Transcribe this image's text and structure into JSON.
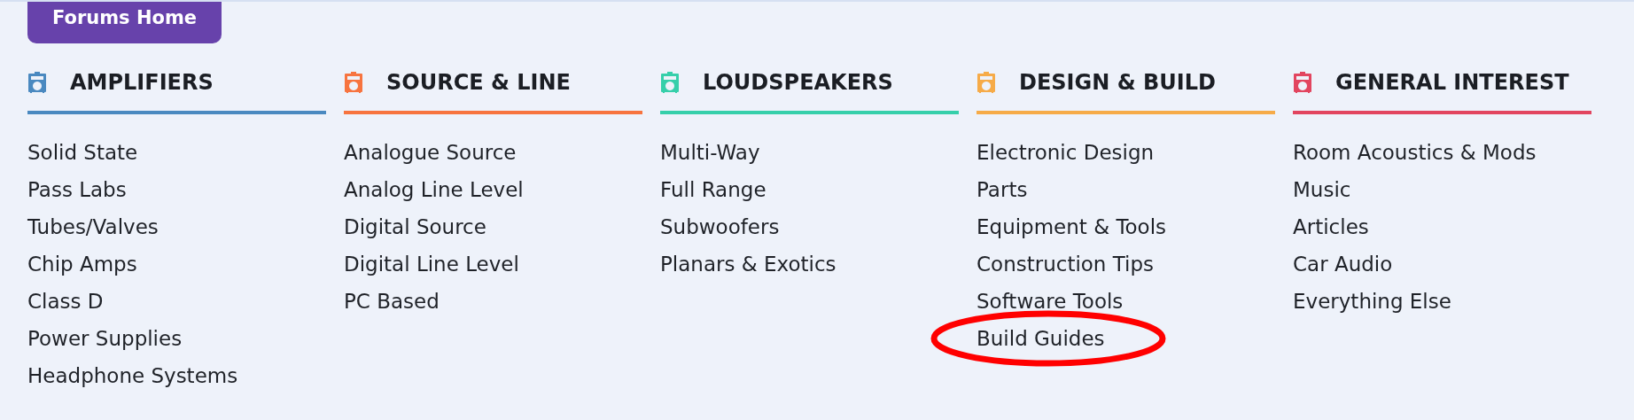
{
  "home_button": {
    "label": "Forums Home"
  },
  "categories": [
    {
      "title": "AMPLIFIERS",
      "color": "#4a89c0",
      "links": [
        {
          "label": "Solid State",
          "circled": false
        },
        {
          "label": "Pass Labs",
          "circled": false
        },
        {
          "label": "Tubes/Valves",
          "circled": false
        },
        {
          "label": "Chip Amps",
          "circled": false
        },
        {
          "label": "Class D",
          "circled": false
        },
        {
          "label": "Power Supplies",
          "circled": false
        },
        {
          "label": "Headphone Systems",
          "circled": false
        }
      ]
    },
    {
      "title": "SOURCE & LINE",
      "color": "#f7743f",
      "links": [
        {
          "label": "Analogue Source",
          "circled": false
        },
        {
          "label": "Analog Line Level",
          "circled": false
        },
        {
          "label": "Digital Source",
          "circled": false
        },
        {
          "label": "Digital Line Level",
          "circled": false
        },
        {
          "label": "PC Based",
          "circled": false
        }
      ]
    },
    {
      "title": "LOUDSPEAKERS",
      "color": "#36cfaa",
      "links": [
        {
          "label": "Multi-Way",
          "circled": false
        },
        {
          "label": "Full Range",
          "circled": false
        },
        {
          "label": "Subwoofers",
          "circled": false
        },
        {
          "label": "Planars & Exotics",
          "circled": false
        }
      ]
    },
    {
      "title": "DESIGN & BUILD",
      "color": "#f6ab48",
      "links": [
        {
          "label": "Electronic Design",
          "circled": false
        },
        {
          "label": "Parts",
          "circled": false
        },
        {
          "label": "Equipment & Tools",
          "circled": false
        },
        {
          "label": "Construction Tips",
          "circled": false
        },
        {
          "label": "Software Tools",
          "circled": false
        },
        {
          "label": "Build Guides",
          "circled": true
        }
      ]
    },
    {
      "title": "GENERAL INTEREST",
      "color": "#e2455f",
      "links": [
        {
          "label": "Room Acoustics & Mods",
          "circled": false
        },
        {
          "label": "Music",
          "circled": false
        },
        {
          "label": "Articles",
          "circled": false
        },
        {
          "label": "Car Audio",
          "circled": false
        },
        {
          "label": "Everything Else",
          "circled": false
        }
      ]
    }
  ]
}
